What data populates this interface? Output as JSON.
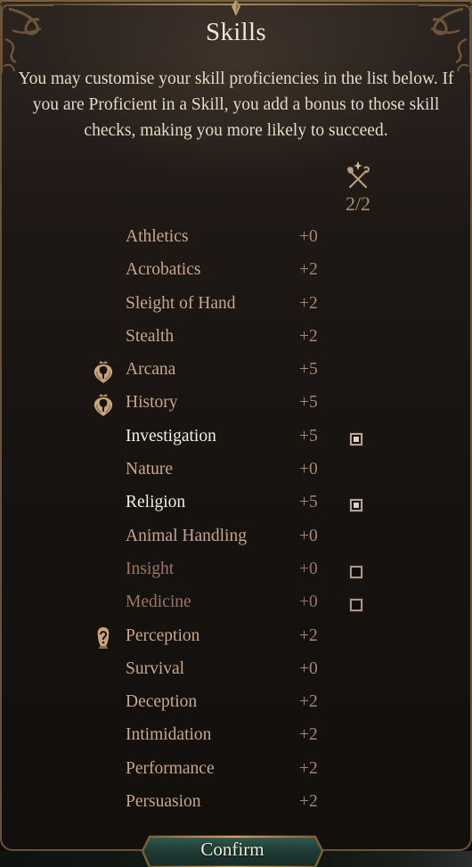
{
  "dialog": {
    "title": "Skills",
    "description": "You may customise your skill proficiencies in the list below. If you are Proficient in a Skill, you add a bonus to those skill checks, making you more likely to succeed."
  },
  "proficiency": {
    "icon": "crossed-axe-and-staff-icon",
    "count": "2/2"
  },
  "skills": [
    {
      "name": "Athletics",
      "modifier": "+0",
      "state": "normal",
      "source_icon": null,
      "checkbox": null
    },
    {
      "name": "Acrobatics",
      "modifier": "+2",
      "state": "normal",
      "source_icon": null,
      "checkbox": null
    },
    {
      "name": "Sleight of Hand",
      "modifier": "+2",
      "state": "normal",
      "source_icon": null,
      "checkbox": null
    },
    {
      "name": "Stealth",
      "modifier": "+2",
      "state": "normal",
      "source_icon": null,
      "checkbox": null
    },
    {
      "name": "Arcana",
      "modifier": "+5",
      "state": "normal",
      "source_icon": "heart-crown-icon",
      "checkbox": null
    },
    {
      "name": "History",
      "modifier": "+5",
      "state": "normal",
      "source_icon": "heart-crown-icon",
      "checkbox": null
    },
    {
      "name": "Investigation",
      "modifier": "+5",
      "state": "highlight",
      "source_icon": null,
      "checkbox": "checked"
    },
    {
      "name": "Nature",
      "modifier": "+0",
      "state": "normal",
      "source_icon": null,
      "checkbox": null
    },
    {
      "name": "Religion",
      "modifier": "+5",
      "state": "highlight",
      "source_icon": null,
      "checkbox": "checked"
    },
    {
      "name": "Animal Handling",
      "modifier": "+0",
      "state": "normal",
      "source_icon": null,
      "checkbox": null
    },
    {
      "name": "Insight",
      "modifier": "+0",
      "state": "dim",
      "source_icon": null,
      "checkbox": "unchecked"
    },
    {
      "name": "Medicine",
      "modifier": "+0",
      "state": "dim",
      "source_icon": null,
      "checkbox": "unchecked"
    },
    {
      "name": "Perception",
      "modifier": "+2",
      "state": "normal",
      "source_icon": "mask-idol-icon",
      "checkbox": null
    },
    {
      "name": "Survival",
      "modifier": "+0",
      "state": "normal",
      "source_icon": null,
      "checkbox": null
    },
    {
      "name": "Deception",
      "modifier": "+2",
      "state": "normal",
      "source_icon": null,
      "checkbox": null
    },
    {
      "name": "Intimidation",
      "modifier": "+2",
      "state": "normal",
      "source_icon": null,
      "checkbox": null
    },
    {
      "name": "Performance",
      "modifier": "+2",
      "state": "normal",
      "source_icon": null,
      "checkbox": null
    },
    {
      "name": "Persuasion",
      "modifier": "+2",
      "state": "normal",
      "source_icon": null,
      "checkbox": null
    }
  ],
  "footer": {
    "confirm_label": "Confirm"
  },
  "colors": {
    "frame_gold": "#8c7048",
    "skill_text": "#c8a68c",
    "skill_highlight": "#f4ede2",
    "button_teal": "#1f3d36"
  }
}
